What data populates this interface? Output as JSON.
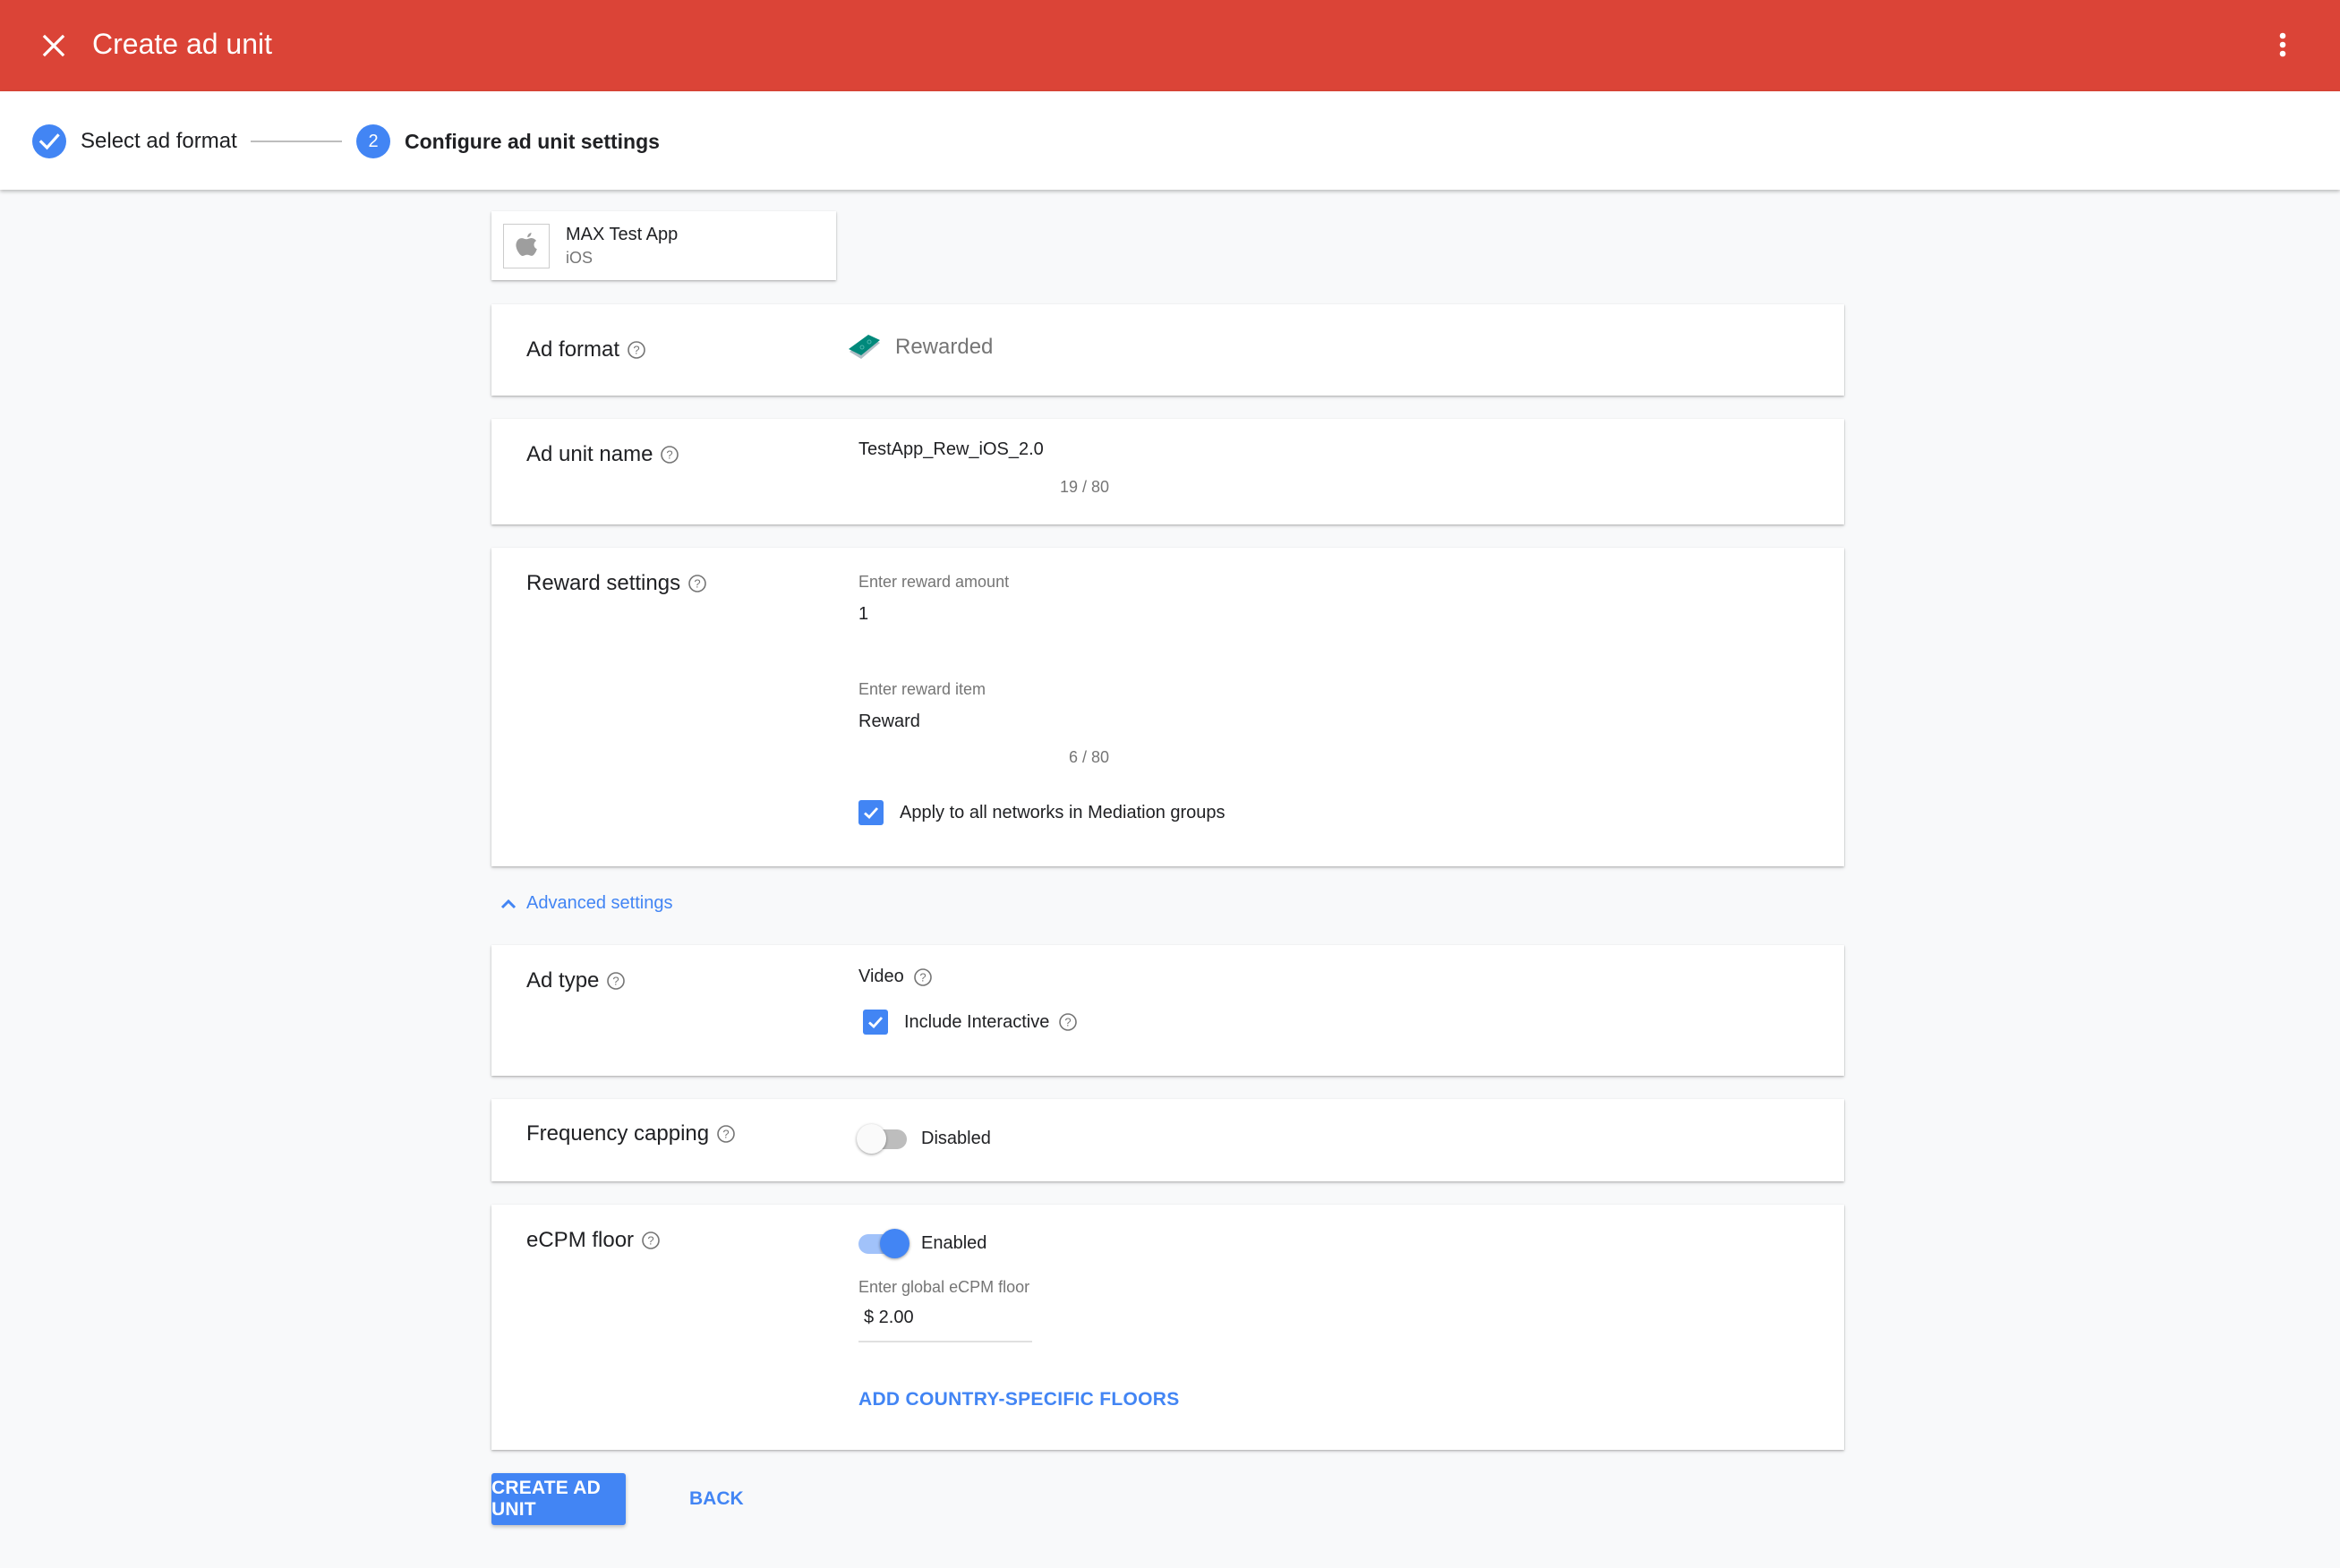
{
  "header": {
    "title": "Create ad unit",
    "close_icon": "close-icon",
    "menu_icon": "more-vert-icon",
    "color": "#db4437"
  },
  "stepper": {
    "steps": [
      {
        "label": "Select ad format",
        "state": "completed",
        "icon": "check-icon"
      },
      {
        "label": "Configure ad unit settings",
        "state": "active",
        "number": "2"
      }
    ]
  },
  "app": {
    "name": "MAX Test App",
    "platform": "iOS",
    "icon": "apple-icon"
  },
  "ad_format": {
    "label": "Ad format",
    "value": "Rewarded",
    "icon": "rewarded-icon"
  },
  "ad_unit_name": {
    "label": "Ad unit name",
    "value": "TestApp_Rew_iOS_2.0",
    "counter": "19 / 80"
  },
  "reward_settings": {
    "label": "Reward settings",
    "amount_label": "Enter reward amount",
    "amount_value": "1",
    "item_label": "Enter reward item",
    "item_value": "Reward",
    "item_counter": "6 / 80",
    "apply_all_label": "Apply to all networks in Mediation groups",
    "apply_all_checked": true
  },
  "advanced_settings": {
    "label": "Advanced settings",
    "expanded": true
  },
  "ad_type": {
    "label": "Ad type",
    "video_label": "Video",
    "interactive_label": "Include Interactive",
    "interactive_checked": true
  },
  "frequency_capping": {
    "label": "Frequency capping",
    "state_label": "Disabled",
    "enabled": false
  },
  "ecpm_floor": {
    "label": "eCPM floor",
    "state_label": "Enabled",
    "enabled": true,
    "floor_label": "Enter global eCPM floor",
    "floor_value": "$ 2.00",
    "add_country_label": "ADD COUNTRY-SPECIFIC FLOORS"
  },
  "actions": {
    "create_label": "CREATE AD UNIT",
    "back_label": "BACK"
  },
  "colors": {
    "accent": "#4285f4",
    "background": "#f8f9fa"
  }
}
